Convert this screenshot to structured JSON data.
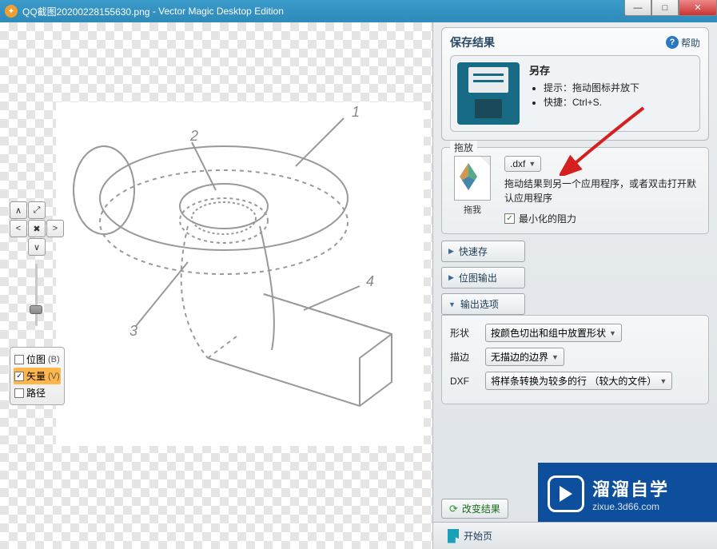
{
  "titlebar": {
    "filename": "QQ截图20200228155630.png",
    "appname": "Vector Magic Desktop Edition"
  },
  "nav": {
    "up": "∧",
    "fit": "⤢",
    "left": "<",
    "one": "✖",
    "right": ">",
    "down": "∨"
  },
  "layers": {
    "bitmap_label": "位图",
    "bitmap_key": "(B)",
    "vector_label": "矢量",
    "vector_key": "(V)",
    "path_label": "路径"
  },
  "right": {
    "save_title": "保存结果",
    "help": "帮助",
    "save_as": "另存",
    "tip_label": "提示：",
    "tip_text": "拖动图标并放下",
    "shortcut_label": "快捷：",
    "shortcut_text": "Ctrl+S.",
    "drag_group": "拖放",
    "drag_icon_label": "拖我",
    "format_selected": ".dxf",
    "drag_desc": "拖动结果到另一个应用程序，或者双击打开默认应用程序",
    "min_resist": "最小化的阻力",
    "quicksave": "快速存",
    "bitmap_out": "位图输出",
    "out_options": "输出选项",
    "shape_lbl": "形状",
    "shape_val": "按颜色切出和组中放置形状",
    "stroke_lbl": "描边",
    "stroke_val": "无描边的边界",
    "dxf_lbl": "DXF",
    "dxf_val": "将样条转换为较多的行 （较大的文件）",
    "change_result": "改变结果",
    "start_page": "开始页"
  },
  "watermark": {
    "name": "溜溜自学",
    "url": "zixue.3d66.com"
  }
}
